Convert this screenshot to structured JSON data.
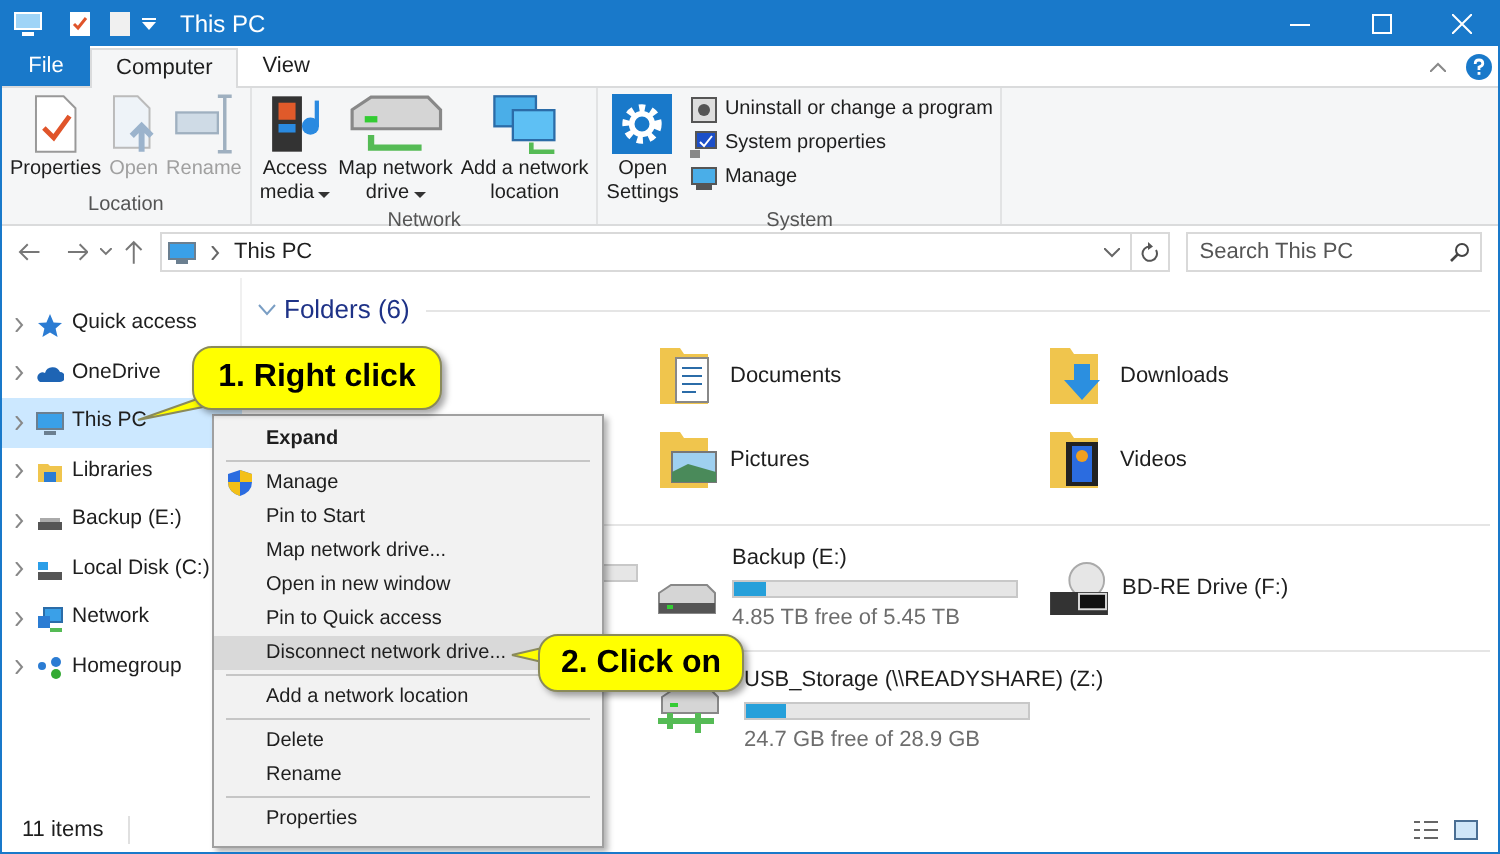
{
  "window": {
    "title": "This PC"
  },
  "ribbon_tabs": [
    {
      "label": "File",
      "kind": "file",
      "selected": false
    },
    {
      "label": "Computer",
      "kind": "tab",
      "selected": true
    },
    {
      "label": "View",
      "kind": "tab",
      "selected": false
    }
  ],
  "ribbon_groups": [
    {
      "label": "Location",
      "buttons": [
        {
          "lines": [
            "Properties"
          ],
          "kind": "properties",
          "disabled": false,
          "dropdown": false
        },
        {
          "lines": [
            "Open"
          ],
          "kind": "open",
          "disabled": true,
          "dropdown": false
        },
        {
          "lines": [
            "Rename"
          ],
          "kind": "rename",
          "disabled": true,
          "dropdown": false
        }
      ]
    },
    {
      "label": "Network",
      "buttons": [
        {
          "lines": [
            "Access",
            "media"
          ],
          "kind": "media",
          "disabled": false,
          "dropdown": true
        },
        {
          "lines": [
            "Map network",
            "drive"
          ],
          "kind": "map",
          "disabled": false,
          "dropdown": true
        },
        {
          "lines": [
            "Add a network",
            "location"
          ],
          "kind": "netloc",
          "disabled": false,
          "dropdown": false
        }
      ]
    },
    {
      "label": "System",
      "buttons": [
        {
          "lines": [
            "Open",
            "Settings"
          ],
          "kind": "settings",
          "disabled": false,
          "dropdown": false
        }
      ],
      "small_buttons": [
        {
          "label": "Uninstall or change a program",
          "kind": "uninstall"
        },
        {
          "label": "System properties",
          "kind": "sysprops"
        },
        {
          "label": "Manage",
          "kind": "manage"
        }
      ]
    }
  ],
  "address": {
    "path": "This PC"
  },
  "search": {
    "placeholder": "Search This PC"
  },
  "nav": [
    {
      "label": "Quick access",
      "kind": "star",
      "selected": false
    },
    {
      "label": "OneDrive",
      "kind": "cloud",
      "selected": false
    },
    {
      "label": "This PC",
      "kind": "pc",
      "selected": true
    },
    {
      "label": "Libraries",
      "kind": "library",
      "selected": false
    },
    {
      "label": "Backup (E:)",
      "kind": "drive",
      "selected": false
    },
    {
      "label": "Local Disk (C:)",
      "kind": "disk",
      "selected": false
    },
    {
      "label": "Network",
      "kind": "network",
      "selected": false
    },
    {
      "label": "Homegroup",
      "kind": "homegroup",
      "selected": false
    }
  ],
  "folders_header": "Folders (6)",
  "folders": [
    {
      "label": "Documents",
      "kind": "documents"
    },
    {
      "label": "Downloads",
      "kind": "downloads"
    },
    {
      "label": "Pictures",
      "kind": "pictures"
    },
    {
      "label": "Videos",
      "kind": "videos"
    }
  ],
  "drives": [
    {
      "name": "Backup (E:)",
      "free": "4.85 TB free of 5.45 TB",
      "level": 0.11,
      "kind": "hdd"
    },
    {
      "name": "BD-RE Drive (F:)",
      "kind": "bd"
    }
  ],
  "network_locations": [
    {
      "name": "USB_Storage (\\\\READYSHARE) (Z:)",
      "free": "24.7 GB free of 28.9 GB",
      "level": 0.14,
      "kind": "netdrive"
    }
  ],
  "context_menu": [
    [
      {
        "label": "Expand",
        "default": true,
        "kind": "plain",
        "selected": false
      }
    ],
    [
      {
        "label": "Manage",
        "default": false,
        "kind": "shield",
        "selected": false
      },
      {
        "label": "Pin to Start",
        "default": false,
        "kind": "plain",
        "selected": false
      },
      {
        "label": "Map network drive...",
        "default": false,
        "kind": "plain",
        "selected": false
      },
      {
        "label": "Open in new window",
        "default": false,
        "kind": "plain",
        "selected": false
      },
      {
        "label": "Pin to Quick access",
        "default": false,
        "kind": "plain",
        "selected": false
      },
      {
        "label": "Disconnect network drive...",
        "default": false,
        "kind": "plain",
        "selected": true
      }
    ],
    [
      {
        "label": "Add a network location",
        "default": false,
        "kind": "plain",
        "selected": false
      }
    ],
    [
      {
        "label": "Delete",
        "default": false,
        "kind": "plain",
        "selected": false
      },
      {
        "label": "Rename",
        "default": false,
        "kind": "plain",
        "selected": false
      }
    ],
    [
      {
        "label": "Properties",
        "default": false,
        "kind": "plain",
        "selected": false
      }
    ]
  ],
  "callouts": [
    {
      "text": "1. Right click"
    },
    {
      "text": "2. Click on"
    }
  ],
  "status_bar": {
    "count": "11 items"
  }
}
